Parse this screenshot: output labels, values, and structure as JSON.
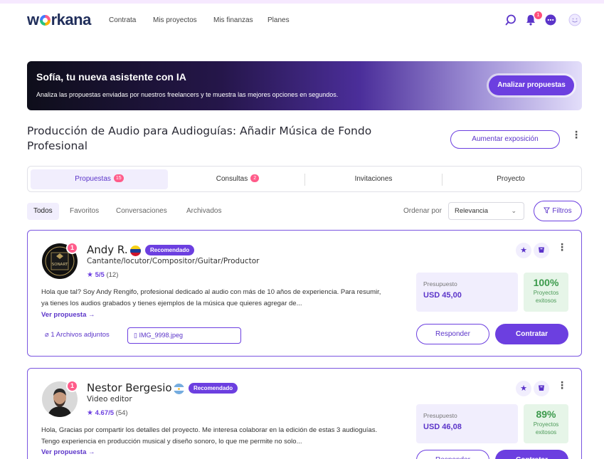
{
  "header": {
    "logo": "workana",
    "nav": [
      "Contrata",
      "Mis proyectos",
      "Mis finanzas",
      "Planes"
    ],
    "notifications_count": "1",
    "icons": [
      "search-icon",
      "bell-icon",
      "chat-icon",
      "avatar-icon"
    ]
  },
  "banner": {
    "title": "Sofía, tu nueva asistente con IA",
    "text": "Analiza las propuestas enviadas por nuestros freelancers y te muestra las mejores opciones en segundos.",
    "button": "Analizar propuestas"
  },
  "project": {
    "title": "Producción de Audio para Audioguías: Añadir Música de Fondo Profesional",
    "boost_button": "Aumentar exposición"
  },
  "tabs": [
    {
      "label": "Propuestas",
      "count": "15"
    },
    {
      "label": "Consultas",
      "count": "2"
    },
    {
      "label": "Invitaciones",
      "count": ""
    },
    {
      "label": "Proyecto",
      "count": ""
    }
  ],
  "filters": {
    "items": [
      "Todos",
      "Favoritos",
      "Conversaciones",
      "Archivados"
    ],
    "sort_label": "Ordenar por",
    "sort_value": "Relevancia",
    "filter_button": "Filtros"
  },
  "proposals": [
    {
      "rank": "1",
      "name": "Andy R.",
      "badge": "Recomendado",
      "role": "Cantante/locutor/Compositor/Guitar/Productor",
      "rating": "5/5",
      "reviews": "(12)",
      "description": "Hola que tal? Soy Andy Rengifo, profesional dedicado al audio con más de 10 años de experiencia. Para resumir, ya tienes los audios grabados y tienes ejemplos de la música que quieres agregar de...",
      "more": "Ver propuesta →",
      "budget_label": "Presupuesto",
      "budget": "USD 45,00",
      "success_pct": "100%",
      "success_label": "Proyectos exitosos",
      "attachments": "1 Archivos adjuntos",
      "file": "IMG_9998.jpeg",
      "reply": "Responder",
      "hire": "Contratar",
      "avatar_text": "SONART"
    },
    {
      "rank": "1",
      "name": "Nestor Bergesio",
      "badge": "Recomendado",
      "role": "Video editor",
      "rating": "4.67/5",
      "reviews": "(54)",
      "description": "Hola, Gracias por compartir los detalles del proyecto. Me interesa colaborar en la edición de estas 3 audioguías. Tengo experiencia en producción musical y diseño sonoro, lo que me permite no solo...",
      "more": "Ver propuesta →",
      "budget_label": "Presupuesto",
      "budget": "USD 46,08",
      "success_pct": "89%",
      "success_label": "Proyectos exitosos",
      "reply": "Responder",
      "hire": "Contratar"
    }
  ],
  "colors": {
    "accent": "#6c3fe0",
    "badge": "#ff5c8a",
    "success": "#3c9a4c"
  }
}
